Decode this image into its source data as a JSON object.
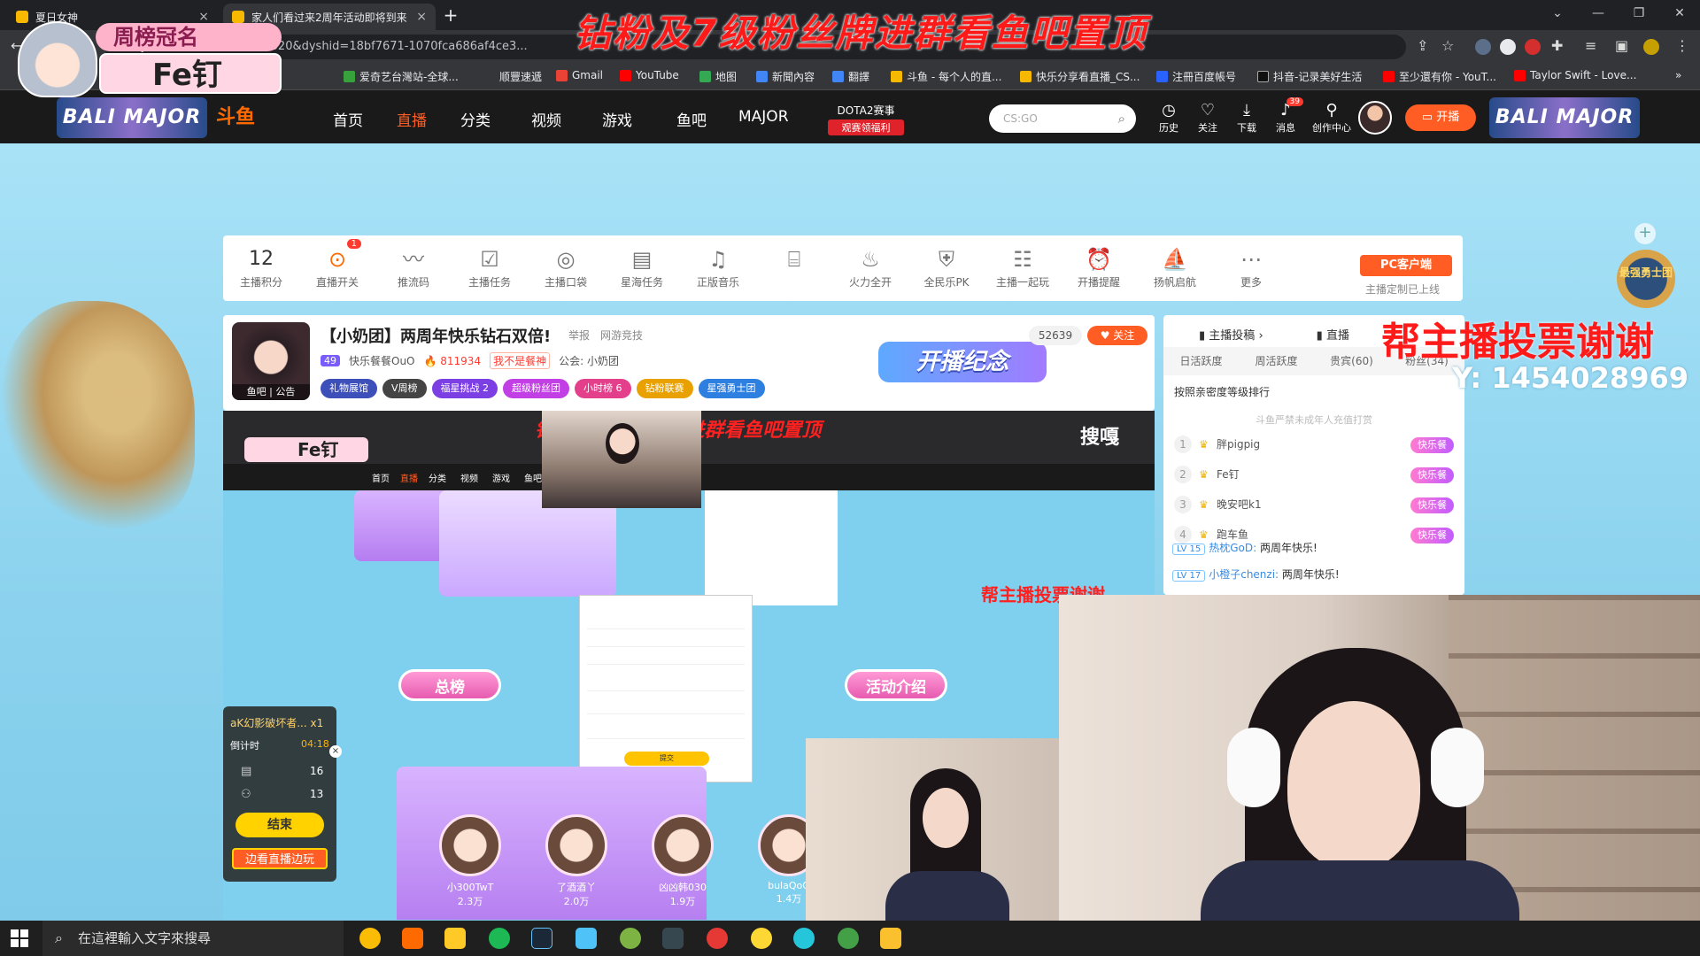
{
  "browser": {
    "tabs": [
      {
        "title": "夏日女神"
      },
      {
        "title": "家人们看过来2周年活动即将到来"
      }
    ],
    "url": "douyu.com/...zx?rid=9988320&dyshid=18bf7671-1070fca686af4ce3...",
    "bookmarks": [
      "爱奇艺台灣站-全球...",
      "顺豐速遞",
      "Gmail",
      "YouTube",
      "地图",
      "新聞內容",
      "翻譯",
      "斗鱼 - 每个人的直...",
      "快乐分享看直播_CS...",
      "注冊百度帳号",
      "抖音-记录美好生活",
      "至少還有你 - YouT...",
      "Taylor Swift - Love..."
    ]
  },
  "overlay": {
    "top_banner": "钻粉及7级粉丝牌进群看鱼吧置顶",
    "rank_title": "周榜冠名",
    "rank_name": "Fe钉",
    "thanks": "帮主播投票谢谢",
    "qq": "Y: 1454028969"
  },
  "header": {
    "banner_left": "BALI MAJOR",
    "banner_right": "BALI MAJOR",
    "logo": "斗鱼",
    "nav": [
      "首页",
      "直播",
      "分类",
      "视频",
      "游戏",
      "鱼吧",
      "MAJOR"
    ],
    "dota_title": "DOTA2赛事",
    "dota_sub": "观赛领福利",
    "search_placeholder": "CS:GO",
    "tools": [
      {
        "label": "历史",
        "badge": ""
      },
      {
        "label": "关注",
        "badge": ""
      },
      {
        "label": "下载",
        "badge": ""
      },
      {
        "label": "消息",
        "badge": "39"
      },
      {
        "label": "创作中心",
        "badge": ""
      }
    ],
    "start_live": "开播"
  },
  "toolbar": {
    "score_value": "12",
    "score_label": "主播积分",
    "items": [
      "直播开关",
      "推流码",
      "主播任务",
      "主播口袋",
      "星海任务",
      "正版音乐",
      "",
      "火力全开",
      "全民乐PK",
      "主播一起玩",
      "开播提醒",
      "扬帆启航",
      "更多"
    ],
    "switch_badge": "1",
    "pc_client": "PC客户端",
    "note": "主播定制已上线"
  },
  "room": {
    "avatar_tag": "鱼吧 | 公告",
    "title": "【小奶团】两周年快乐钻石双倍!",
    "report": "举报",
    "category": "网游竞技",
    "viewers": "52639",
    "follow": "关注",
    "level": "49",
    "streamer": "快乐餐餐OuO",
    "hot": "811934",
    "flag": "我不是餐神",
    "announce": "公会: 小奶团",
    "badges": [
      "礼物展馆",
      "V周榜",
      "福星挑战 2",
      "超级粉丝团",
      "小时榜 6",
      "钻粉联赛",
      "星强勇士团"
    ],
    "anniversary": "开播纪念"
  },
  "video": {
    "nested_title": "钻粉及7级粉丝牌进群看鱼吧置顶",
    "nested_name": "Fe钉",
    "nested_brand": "搜嘎",
    "nested_overlay": "帮主播投票谢谢",
    "btn_total": "总榜",
    "btn_intro": "活动介绍",
    "avatars": [
      {
        "name": "小300TwT",
        "value": "2.3万"
      },
      {
        "name": "了酒酒丫",
        "value": "2.0万"
      },
      {
        "name": "凶凶韩030",
        "value": "1.9万"
      },
      {
        "name": "bulaQoQ",
        "value": "1.4万"
      }
    ],
    "dialog_submit": "提交"
  },
  "countdown": {
    "title": "aK幻影破坏者... x1",
    "label": "倒计时",
    "value": "04:18",
    "count1": "16",
    "count2": "13",
    "end": "结束",
    "watch": "边看直播边玩"
  },
  "rank_panel": {
    "tab_left": "主播投稿",
    "tab_right": "直播",
    "tabs": [
      "日活跃度",
      "周活跃度",
      "贵宾(60)",
      "粉丝(34)"
    ],
    "sub": "按照亲密度等级排行",
    "tip": "斗鱼严禁未成年人充值打赏",
    "rows": [
      {
        "no": "1",
        "name": "胖pigpig",
        "tag": "快乐餐"
      },
      {
        "no": "2",
        "name": "Fe钉",
        "tag": "快乐餐"
      },
      {
        "no": "3",
        "name": "晚安吧k1",
        "tag": "快乐餐"
      },
      {
        "no": "4",
        "name": "跑车鱼",
        "tag": "快乐餐"
      }
    ]
  },
  "chat": [
    {
      "lv": "LV 15",
      "nick": "热枕GoD:",
      "msg": "两周年快乐!"
    },
    {
      "lv": "LV 17",
      "nick": "小橙子chenzi:",
      "msg": "两周年快乐!"
    }
  ],
  "side_badge": "最强勇士团",
  "taskbar": {
    "search_placeholder": "在這裡輸入文字來搜尋"
  }
}
